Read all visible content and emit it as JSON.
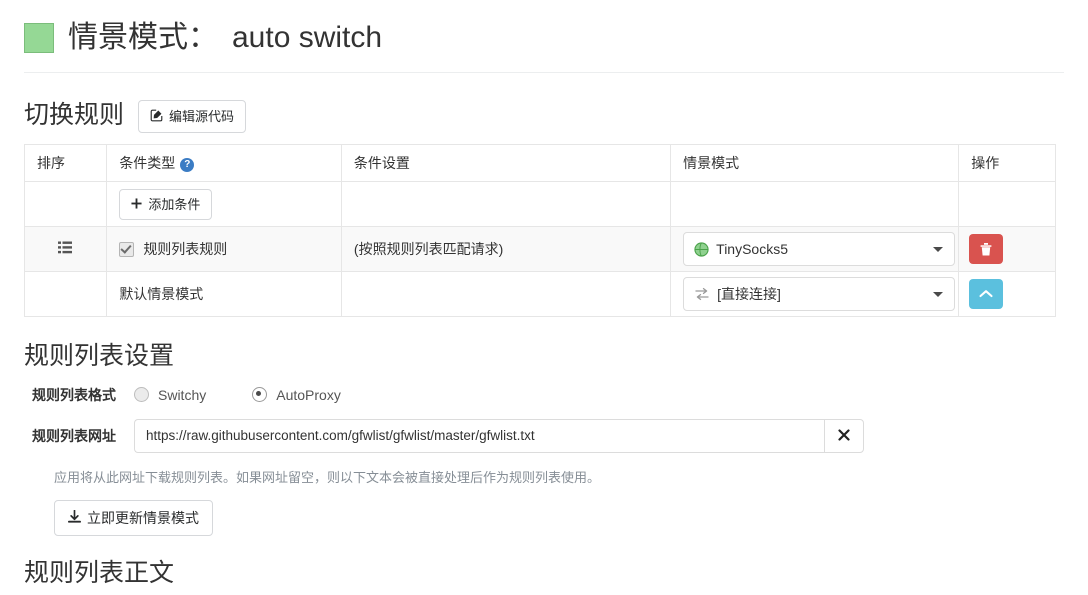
{
  "header": {
    "profile_color": "#95d895",
    "label": "情景模式：",
    "profile_name": "auto switch"
  },
  "rules_section": {
    "heading": "切换规则",
    "edit_source_button": "编辑源代码",
    "edit_icon": "pencil-square-icon",
    "table": {
      "columns": [
        "排序",
        "条件类型",
        "条件设置",
        "情景模式",
        "操作"
      ],
      "help_icon": "?",
      "add_condition_button": "添加条件",
      "add_icon": "plus-icon",
      "rows": [
        {
          "drag_icon": "drag-handle-icon",
          "checkbox_checked": true,
          "condition_type": "规则列表规则",
          "condition_detail": "(按照规则列表匹配请求)",
          "profile": "TinySocks5",
          "profile_icon": "globe-icon",
          "profile_icon_color": "#5cb85c",
          "action_icon": "trash-icon",
          "action_color": "#d9534f"
        },
        {
          "drag_icon": "",
          "condition_type": "默认情景模式",
          "condition_detail": "",
          "profile": "[直接连接]",
          "profile_icon": "direct-connect-icon",
          "action_icon": "chevron-up-icon",
          "action_color": "#5bc0de"
        }
      ]
    }
  },
  "list_settings": {
    "heading": "规则列表设置",
    "format_label": "规则列表格式",
    "format_options": [
      {
        "label": "Switchy",
        "selected": false
      },
      {
        "label": "AutoProxy",
        "selected": true
      }
    ],
    "url_label": "规则列表网址",
    "url_value": "https://raw.githubusercontent.com/gfwlist/gfwlist/master/gfwlist.txt",
    "url_placeholder": "",
    "clear_icon": "close-icon",
    "hint": "应用将从此网址下载规则列表。如果网址留空，则以下文本会被直接处理后作为规则列表使用。",
    "update_button": "立即更新情景模式",
    "update_icon": "download-icon"
  },
  "list_body": {
    "heading": "规则列表正文"
  }
}
